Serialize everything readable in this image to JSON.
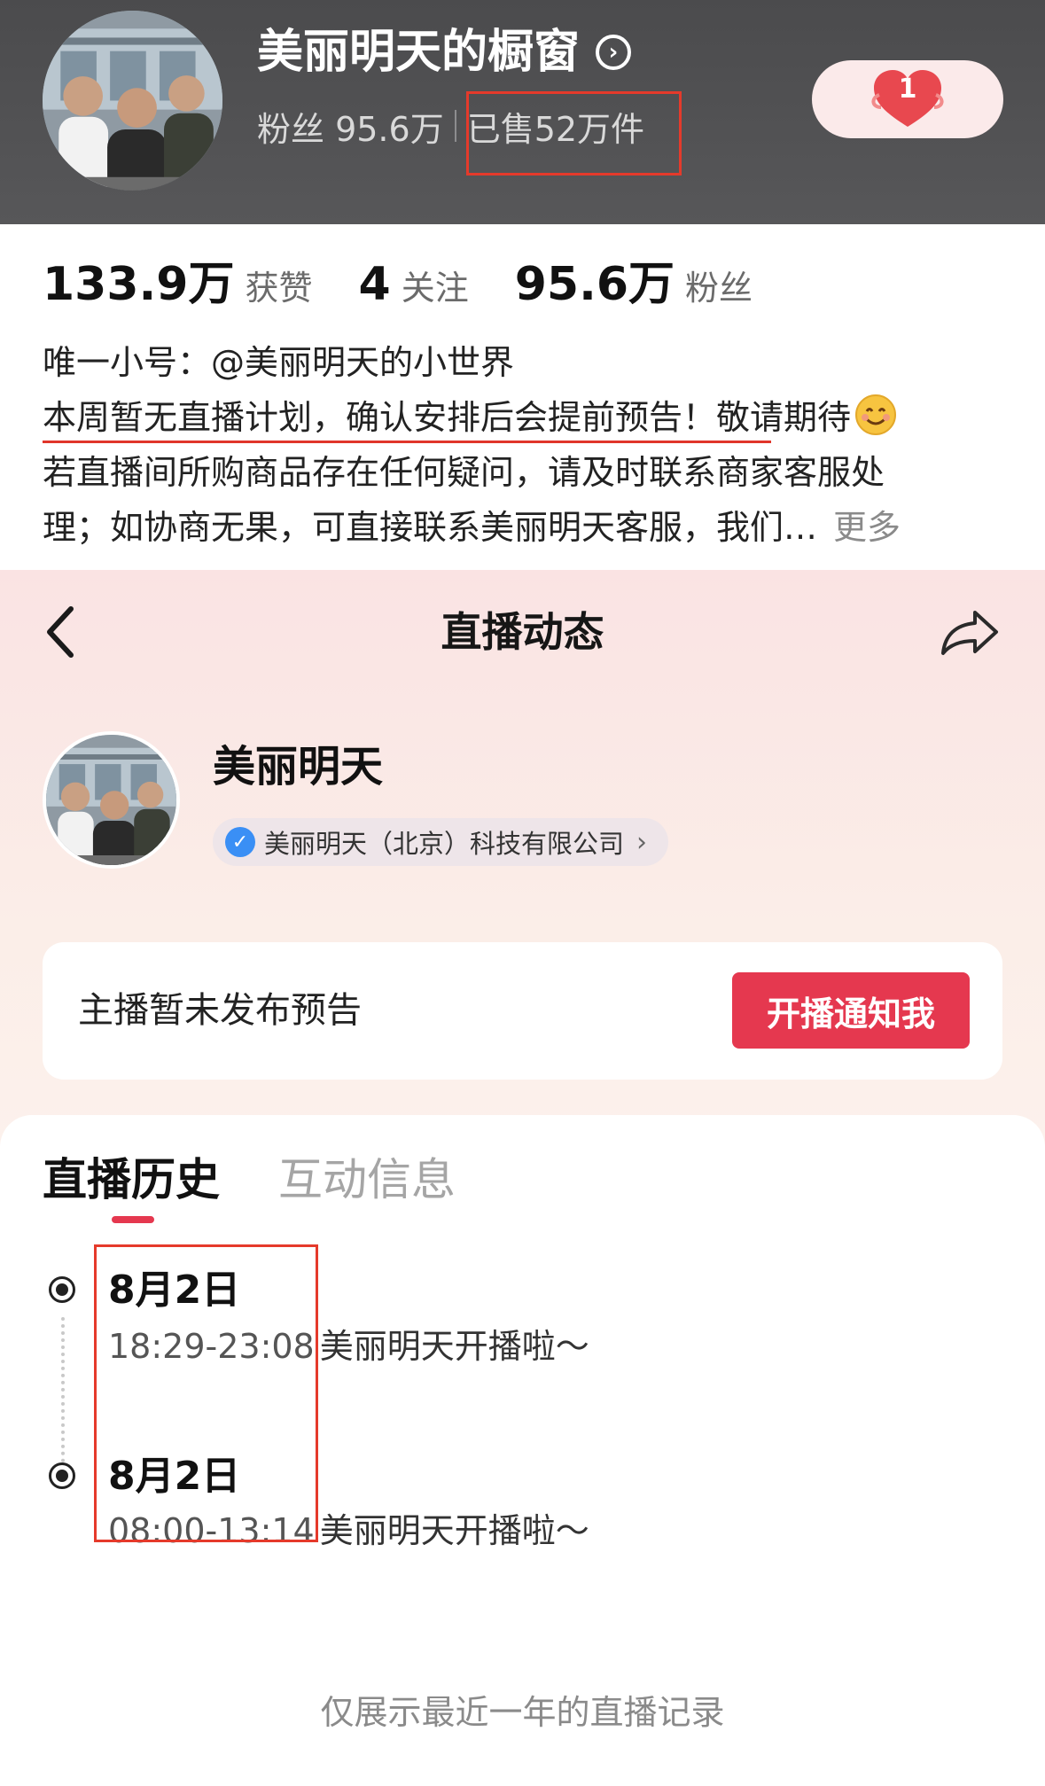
{
  "shop": {
    "title": "美丽明天的橱窗",
    "fans_text": "粉丝 95.6万",
    "sold_text": "已售52万件",
    "cart_count": "1"
  },
  "profile": {
    "likes_num": "133.9万",
    "likes_label": "获赞",
    "following_num": "4",
    "following_label": "关注",
    "fans_num": "95.6万",
    "fans_label": "粉丝",
    "bio": [
      "唯一小号：@美丽明天的小世界",
      "本周暂无直播计划，确认安排后会提前预告！",
      "敬请期待",
      "若直播间所购商品存在任何疑问，请及时联系商家客服处",
      "理；如协商无果，可直接联系美丽明天客服，我们…"
    ],
    "more_label": "更多"
  },
  "live": {
    "nav_title": "直播动态",
    "anchor_name": "美丽明天",
    "verified_company": "美丽明天（北京）科技有限公司",
    "notice_text": "主播暂未发布预告",
    "notify_button": "开播通知我"
  },
  "history": {
    "tabs": [
      {
        "label": "直播历史",
        "active": true
      },
      {
        "label": "互动信息",
        "active": false
      }
    ],
    "entries": [
      {
        "date": "8月2日",
        "time": "18:29-23:08",
        "desc": "美丽明天开播啦～"
      },
      {
        "date": "8月2日",
        "time": "08:00-13:14",
        "desc": "美丽明天开播啦～"
      }
    ],
    "footer_note": "仅展示最近一年的直播记录"
  },
  "colors": {
    "accent_red": "#e5384f",
    "annotation_red": "#e53a2b",
    "header_bg": "#505052",
    "verify_blue": "#3a8ff5"
  }
}
